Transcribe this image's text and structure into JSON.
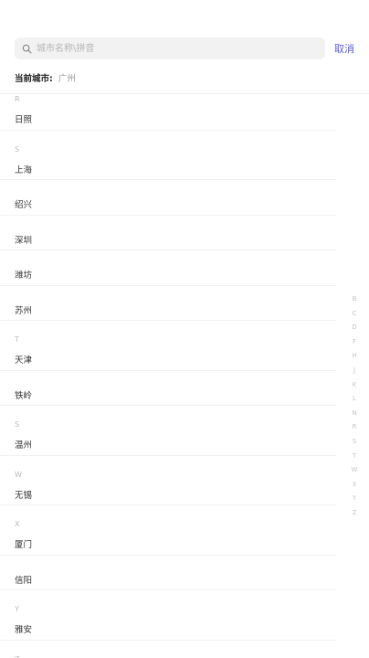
{
  "search": {
    "placeholder": "城市名称\\拼音",
    "cancel_label": "取消"
  },
  "current_city": {
    "label": "当前城市:",
    "value": "广州"
  },
  "list": [
    {
      "letter": "R"
    },
    {
      "city": "日照"
    },
    {
      "letter": "S"
    },
    {
      "city": "上海"
    },
    {
      "city": "绍兴"
    },
    {
      "city": "深圳"
    },
    {
      "city": "潍坊"
    },
    {
      "city": "苏州"
    },
    {
      "letter": "T"
    },
    {
      "city": "天津"
    },
    {
      "city": "铁岭"
    },
    {
      "letter": "S"
    },
    {
      "city": "温州"
    },
    {
      "letter": "W"
    },
    {
      "city": "无锡"
    },
    {
      "letter": "X"
    },
    {
      "city": "厦门"
    },
    {
      "city": "信阳"
    },
    {
      "letter": "Y"
    },
    {
      "city": "雅安"
    },
    {
      "letter": "Z"
    }
  ],
  "index_letters": [
    "B",
    "C",
    "D",
    "F",
    "H",
    "J",
    "K",
    "L",
    "N",
    "R",
    "S",
    "T",
    "W",
    "X",
    "Y",
    "Z"
  ],
  "colors": {
    "accent": "#5b5bd6",
    "caret": "#4aa58a"
  }
}
